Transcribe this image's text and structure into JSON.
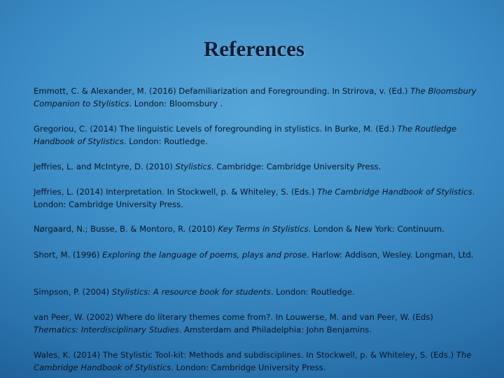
{
  "slide": {
    "title": "References",
    "references": [
      [
        {
          "t": "Emmott, C. & Alexander, M. (2016) Defamiliarization and Foregrounding. In Strirova, v. (Ed.) ",
          "i": false
        },
        {
          "t": "The Bloomsbury Companion to Stylistics",
          "i": true
        },
        {
          "t": ". London: Bloomsbury .",
          "i": false
        }
      ],
      [
        {
          "t": "Gregoriou, C. (2014) The linguistic Levels of foregrounding in stylistics. In Burke, M. (Ed.) ",
          "i": false
        },
        {
          "t": "The Routledge Handbook of Stylistics",
          "i": true
        },
        {
          "t": ". London: Routledge.",
          "i": false
        }
      ],
      [
        {
          "t": "Jeffries, L. and McIntyre, D. (2010) ",
          "i": false
        },
        {
          "t": "Stylistics",
          "i": true
        },
        {
          "t": ". Cambridge: Cambridge University Press.",
          "i": false
        }
      ],
      [
        {
          "t": "Jeffries, L. (2014) Interpretation. In Stockwell, p. & Whiteley, S. (Eds.) ",
          "i": false
        },
        {
          "t": "The Cambridge Handbook of Stylistics",
          "i": true
        },
        {
          "t": ". London: Cambridge University Press.",
          "i": false
        }
      ],
      [
        {
          "t": "Nørgaard, N.; Busse, B. & Montoro, R. (2010) ",
          "i": false
        },
        {
          "t": "Key Terms in Stylistics",
          "i": true
        },
        {
          "t": ". London & New York: Continuum.",
          "i": false
        }
      ],
      [
        {
          "t": "Short, M. (1996) ",
          "i": false
        },
        {
          "t": "Exploring the language of poems, plays and prose",
          "i": true
        },
        {
          "t": ". Harlow: Addison, Wesley. Longman, Ltd.",
          "i": false
        }
      ],
      [
        {
          "t": "Simpson, P. (2004) ",
          "i": false
        },
        {
          "t": "Stylistics: A resource book for students",
          "i": true
        },
        {
          "t": ". London: Routledge.",
          "i": false
        }
      ],
      [
        {
          "t": "van Peer, W. (2002) Where do literary themes come from?. In Louwerse, M. and van Peer, W. (Eds) ",
          "i": false
        },
        {
          "t": "Thematics: Interdisciplinary Studies",
          "i": true
        },
        {
          "t": ". Amsterdam and Philadelphia: John Benjamins.",
          "i": false
        }
      ],
      [
        {
          "t": "Wales, K. (2014) The Stylistic Tool-kit: Methods and subdisciplines. In Stockwell, p. & Whiteley, S. (Eds.) ",
          "i": false
        },
        {
          "t": "The Cambridge Handbook of Stylistics",
          "i": true
        },
        {
          "t": ". London: Cambridge University Press.",
          "i": false
        }
      ]
    ]
  }
}
